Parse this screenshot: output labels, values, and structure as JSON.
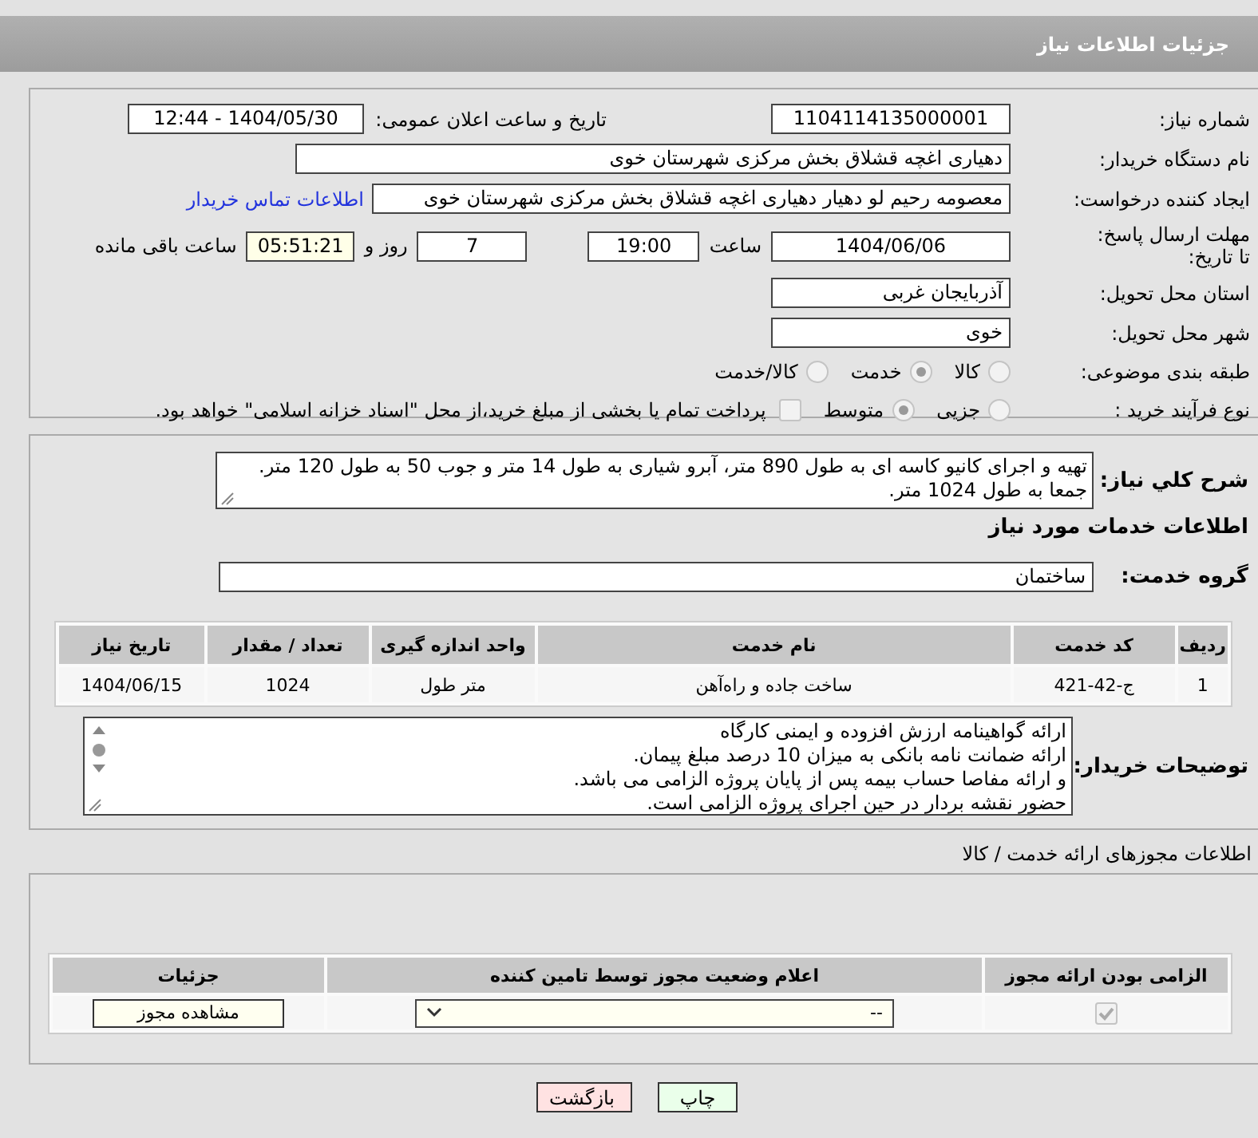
{
  "header": {
    "title": "جزئیات اطلاعات نیاز"
  },
  "summary": {
    "need_number": {
      "label": "شماره نیاز:",
      "value": "1104114135000001"
    },
    "announce": {
      "label": "تاریخ و ساعت اعلان عمومی:",
      "value": "1404/05/30 - 12:44"
    },
    "buyer_org": {
      "label": "نام دستگاه خریدار:",
      "value": "دهیاری اغچه قشلاق بخش مرکزی شهرستان خوی"
    },
    "requester": {
      "label": "ایجاد کننده درخواست:",
      "value": "معصومه رحیم لو دهیار دهیاری اغچه قشلاق بخش مرکزی شهرستان خوی",
      "contact_link": "اطلاعات تماس خریدار"
    },
    "deadline": {
      "label": "مهلت ارسال پاسخ: تا تاریخ:",
      "date": "1404/06/06",
      "time_label": "ساعت",
      "time": "19:00",
      "days": "7",
      "days_label": "روز و",
      "remaining": "05:51:21",
      "remaining_label": "ساعت باقی مانده"
    },
    "province": {
      "label": "استان محل تحویل:",
      "value": "آذربایجان غربی"
    },
    "city": {
      "label": "شهر محل تحویل:",
      "value": "خوی"
    },
    "category": {
      "label": "طبقه بندی موضوعی:",
      "options": [
        {
          "label": "کالا",
          "selected": false
        },
        {
          "label": "خدمت",
          "selected": true
        },
        {
          "label": "کالا/خدمت",
          "selected": false
        }
      ]
    },
    "purchase_type": {
      "label": "نوع فرآیند خرید :",
      "options": [
        {
          "label": "جزیی",
          "selected": false
        },
        {
          "label": "متوسط",
          "selected": true
        }
      ],
      "treasury": {
        "checked": false,
        "text": "پرداخت تمام یا بخشی از مبلغ خرید،از محل \"اسناد خزانه اسلامی\" خواهد بود."
      }
    }
  },
  "details": {
    "description": {
      "label": "شرح کلي نیاز:",
      "value": "تهیه و اجرای کانیو کاسه ای به طول 890 متر، آبرو شیاری به طول 14 متر و جوب 50 به طول 120 متر. جمعا به طول 1024 متر."
    },
    "heading": "اطلاعات خدمات مورد نیاز",
    "group": {
      "label": "گروه خدمت:",
      "value": "ساختمان"
    },
    "table": {
      "columns": [
        "ردیف",
        "کد خدمت",
        "نام خدمت",
        "واحد اندازه گیری",
        "تعداد / مقدار",
        "تاریخ نیاز"
      ],
      "rows": [
        [
          "1",
          "ج-42-421",
          "ساخت جاده و راه‌آهن",
          "متر طول",
          "1024",
          "1404/06/15"
        ]
      ]
    },
    "notes": {
      "label": "توضیحات خریدار:",
      "value": "ارائه گواهینامه ارزش افزوده و ایمنی کارگاه\nارائه ضمانت نامه بانکی به میزان 10 درصد مبلغ پیمان.\nو ارائه مفاصا حساب بیمه پس از پایان پروژه الزامی می باشد.\nحضور نقشه بردار در حین اجرای پروژه الزامی است."
    }
  },
  "licenses": {
    "title": "اطلاعات مجوزهای ارائه خدمت / کالا",
    "columns": [
      "الزامی بودن ارائه مجوز",
      "اعلام وضعیت مجوز توسط تامین کننده",
      "جزئیات"
    ],
    "rows": [
      {
        "required": true,
        "status": "--",
        "details_button": "مشاهده مجوز"
      }
    ]
  },
  "actions": [
    {
      "label": "چاپ",
      "kind": "print"
    },
    {
      "label": "بازگشت",
      "kind": "back"
    }
  ]
}
